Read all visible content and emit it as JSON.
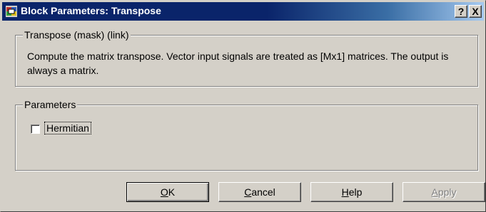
{
  "window": {
    "title": "Block Parameters: Transpose",
    "help_glyph": "?",
    "close_glyph": "X"
  },
  "description": {
    "legend": "Transpose (mask) (link)",
    "text": "Compute the matrix transpose.  Vector input signals are treated as [Mx1] matrices. The output is always a matrix."
  },
  "parameters": {
    "legend": "Parameters",
    "hermitian": {
      "label": "Hermitian",
      "checked": false
    }
  },
  "buttons": {
    "ok": {
      "mnemonic": "O",
      "rest": "K"
    },
    "cancel": {
      "mnemonic": "C",
      "rest": "ancel"
    },
    "help": {
      "mnemonic": "H",
      "rest": "elp"
    },
    "apply": {
      "mnemonic": "A",
      "rest": "pply"
    }
  },
  "icons": {
    "app": "simulink-block-icon",
    "help": "help-icon",
    "close": "close-icon"
  },
  "colors": {
    "titlebar_start": "#0a246a",
    "titlebar_end": "#a6caf0",
    "face": "#d4d0c8"
  }
}
